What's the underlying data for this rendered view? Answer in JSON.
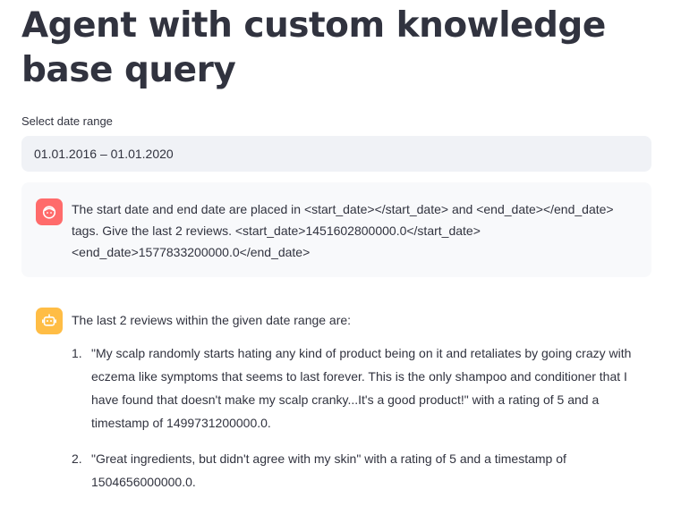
{
  "header": {
    "title": "Agent with custom knowledge base query"
  },
  "date_range": {
    "label": "Select date range",
    "value": "01.01.2016 – 01.01.2020"
  },
  "chat": {
    "user_message": "The start date and end date are placed in <start_date></start_date> and <end_date></end_date> tags. Give the last 2 reviews. <start_date>1451602800000.0</start_date> <end_date>1577833200000.0</end_date>",
    "assistant_intro": "The last 2 reviews within the given date range are:",
    "reviews": [
      {
        "number": "1.",
        "text": "\"My scalp randomly starts hating any kind of product being on it and retaliates by going crazy with eczema like symptoms that seems to last forever. This is the only shampoo and conditioner that I have found that doesn't make my scalp cranky...It's a good product!\" with a rating of 5 and a timestamp of 1499731200000.0."
      },
      {
        "number": "2.",
        "text": "\"Great ingredients, but didn't agree with my skin\" with a rating of 5 and a timestamp of 1504656000000.0."
      }
    ]
  },
  "icons": {
    "user_avatar": "user-face-icon",
    "assistant_avatar": "robot-icon"
  },
  "colors": {
    "user_avatar": "#ff6b6b",
    "assistant_avatar": "#ffbd45",
    "input_bg": "#f0f2f6",
    "user_message_bg": "#f8f9fb",
    "text": "#31333f"
  }
}
